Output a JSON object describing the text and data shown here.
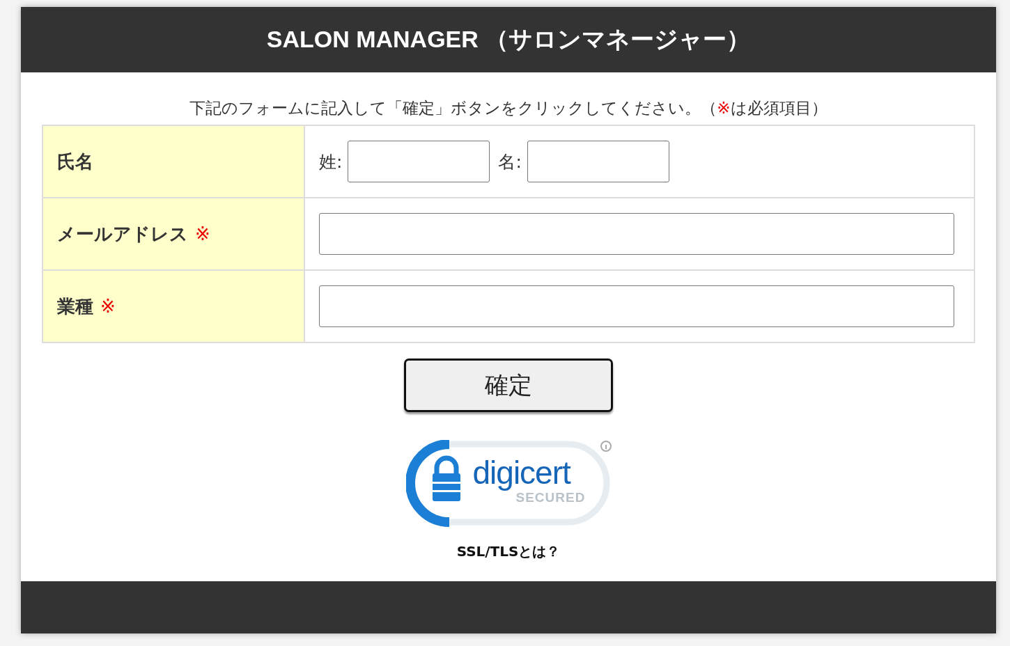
{
  "header": {
    "title": "SALON MANAGER （サロンマネージャー）"
  },
  "intro": {
    "before": "下記のフォームに記入して「確定」ボタンをクリックしてください。（",
    "mark": "※",
    "after": "は必須項目）"
  },
  "rows": [
    {
      "kind": "name",
      "label": "氏名",
      "fields": [
        {
          "label": "姓:"
        },
        {
          "label": "名:"
        }
      ]
    },
    {
      "kind": "text",
      "label": "メールアドレス",
      "mark": "※"
    },
    {
      "kind": "text",
      "label": "業種",
      "mark": "※"
    }
  ],
  "submit": {
    "label": "確定"
  },
  "seal": {
    "brand": "digicert",
    "sub": "SECURED"
  },
  "ssl_link": "SSL/TLSとは？"
}
